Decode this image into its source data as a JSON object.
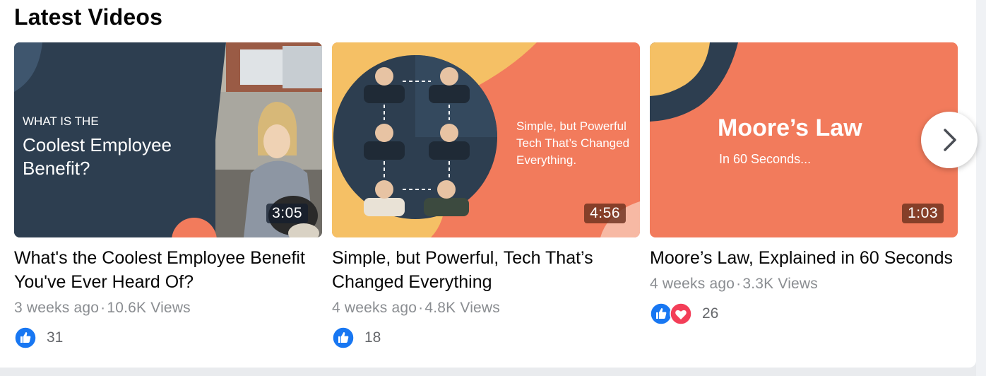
{
  "section": {
    "title": "Latest Videos"
  },
  "videos": [
    {
      "thumb": {
        "small": "WHAT IS THE",
        "big1": "Coolest Employee",
        "big2": "Benefit?"
      },
      "duration": "3:05",
      "title": "What's the Coolest Employee Benefit You've Ever Heard Of?",
      "age": "3 weeks ago",
      "views": "10.6K Views",
      "reactions": [
        "like-icon"
      ],
      "count": "31"
    },
    {
      "thumb": {
        "line1": "Simple, but Powerful",
        "line2": "Tech That’s Changed",
        "line3": "Everything."
      },
      "duration": "4:56",
      "title": "Simple, but Powerful, Tech That’s Changed Everything",
      "age": "4 weeks ago",
      "views": "4.8K Views",
      "reactions": [
        "like-icon"
      ],
      "count": "18"
    },
    {
      "thumb": {
        "big": "Moore’s Law",
        "small": "In 60 Seconds..."
      },
      "duration": "1:03",
      "title": "Moore’s Law, Explained in 60 Seconds",
      "age": "4 weeks ago",
      "views": "3.3K Views",
      "reactions": [
        "like-icon",
        "love-icon"
      ],
      "count": "26"
    }
  ],
  "separator": "·",
  "colors": {
    "navy": "#2d3e50",
    "coral": "#f27b5c",
    "yellow": "#f5c065",
    "like_blue": "#1877f2",
    "love_red": "#f33e58"
  }
}
